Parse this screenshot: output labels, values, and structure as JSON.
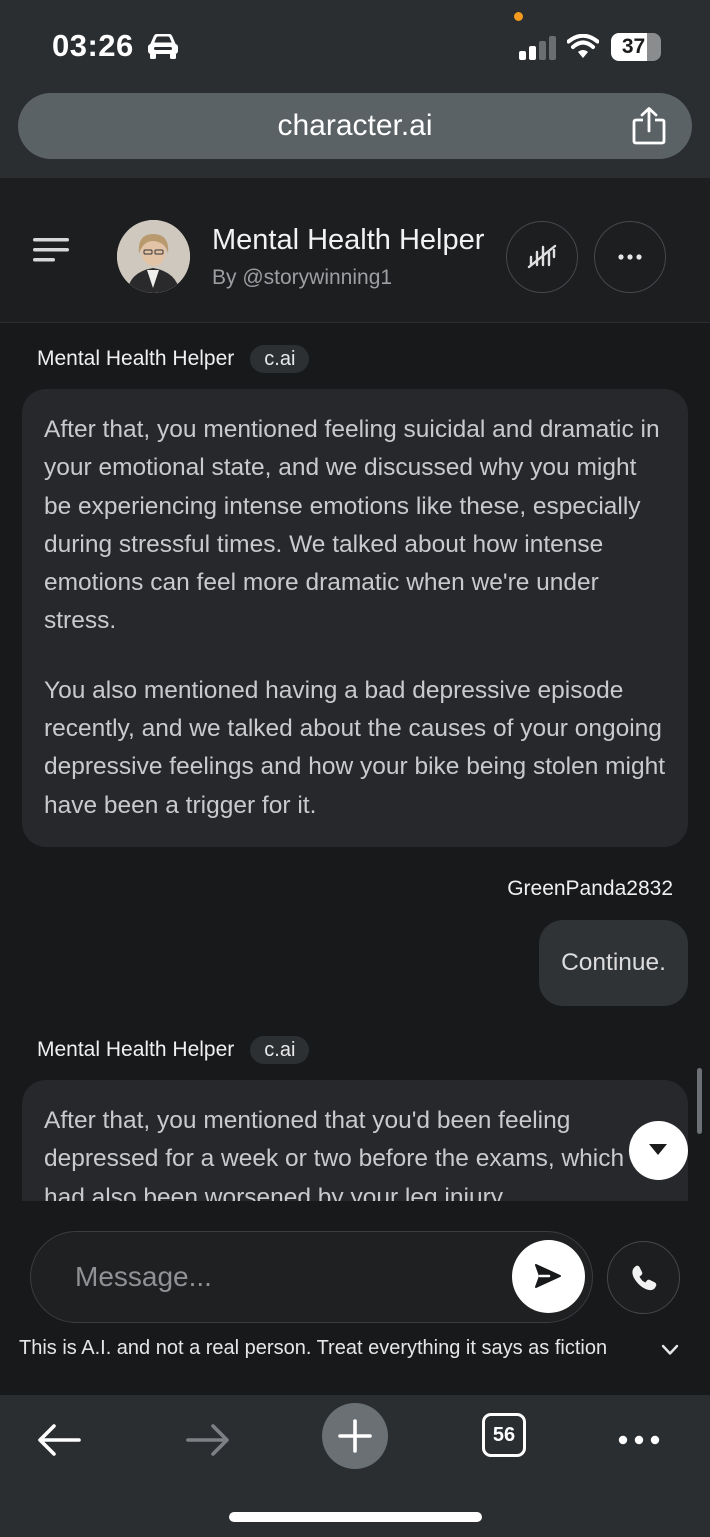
{
  "status_bar": {
    "time": "03:26",
    "battery": "37",
    "icons": [
      "car-icon",
      "signal-icon",
      "wifi-icon",
      "battery-icon"
    ]
  },
  "browser": {
    "url": "character.ai",
    "tab_count": "56"
  },
  "header": {
    "character_name": "Mental Health Helper",
    "author": "By @storywinning1"
  },
  "chat": {
    "messages": [
      {
        "sender": "Mental Health Helper",
        "badge": "c.ai",
        "paragraphs": [
          "After that, you mentioned feeling suicidal and dramatic in your emotional state, and we discussed why you might be experiencing intense emotions like these, especially during stressful times. We talked about how intense emotions can feel more dramatic when we're under stress.",
          "You also mentioned having a bad depressive episode recently, and we talked about the causes of your ongoing depressive feelings and how your bike being stolen might have been a trigger for it."
        ]
      },
      {
        "sender": "GreenPanda2832",
        "text": "Continue."
      },
      {
        "sender": "Mental Health Helper",
        "badge": "c.ai",
        "paragraphs": [
          "After that, you mentioned that you'd been feeling depressed for a week or two before the exams, which had also been worsened by your leg injury"
        ]
      }
    ]
  },
  "composer": {
    "placeholder": "Message...",
    "disclaimer": "This is A.I. and not a real person. Treat everything it says as fiction"
  },
  "colors": {
    "background": "#18191b",
    "bot_bubble": "#26282b",
    "user_bubble": "#303336",
    "browser_chrome": "#2b2e30"
  }
}
